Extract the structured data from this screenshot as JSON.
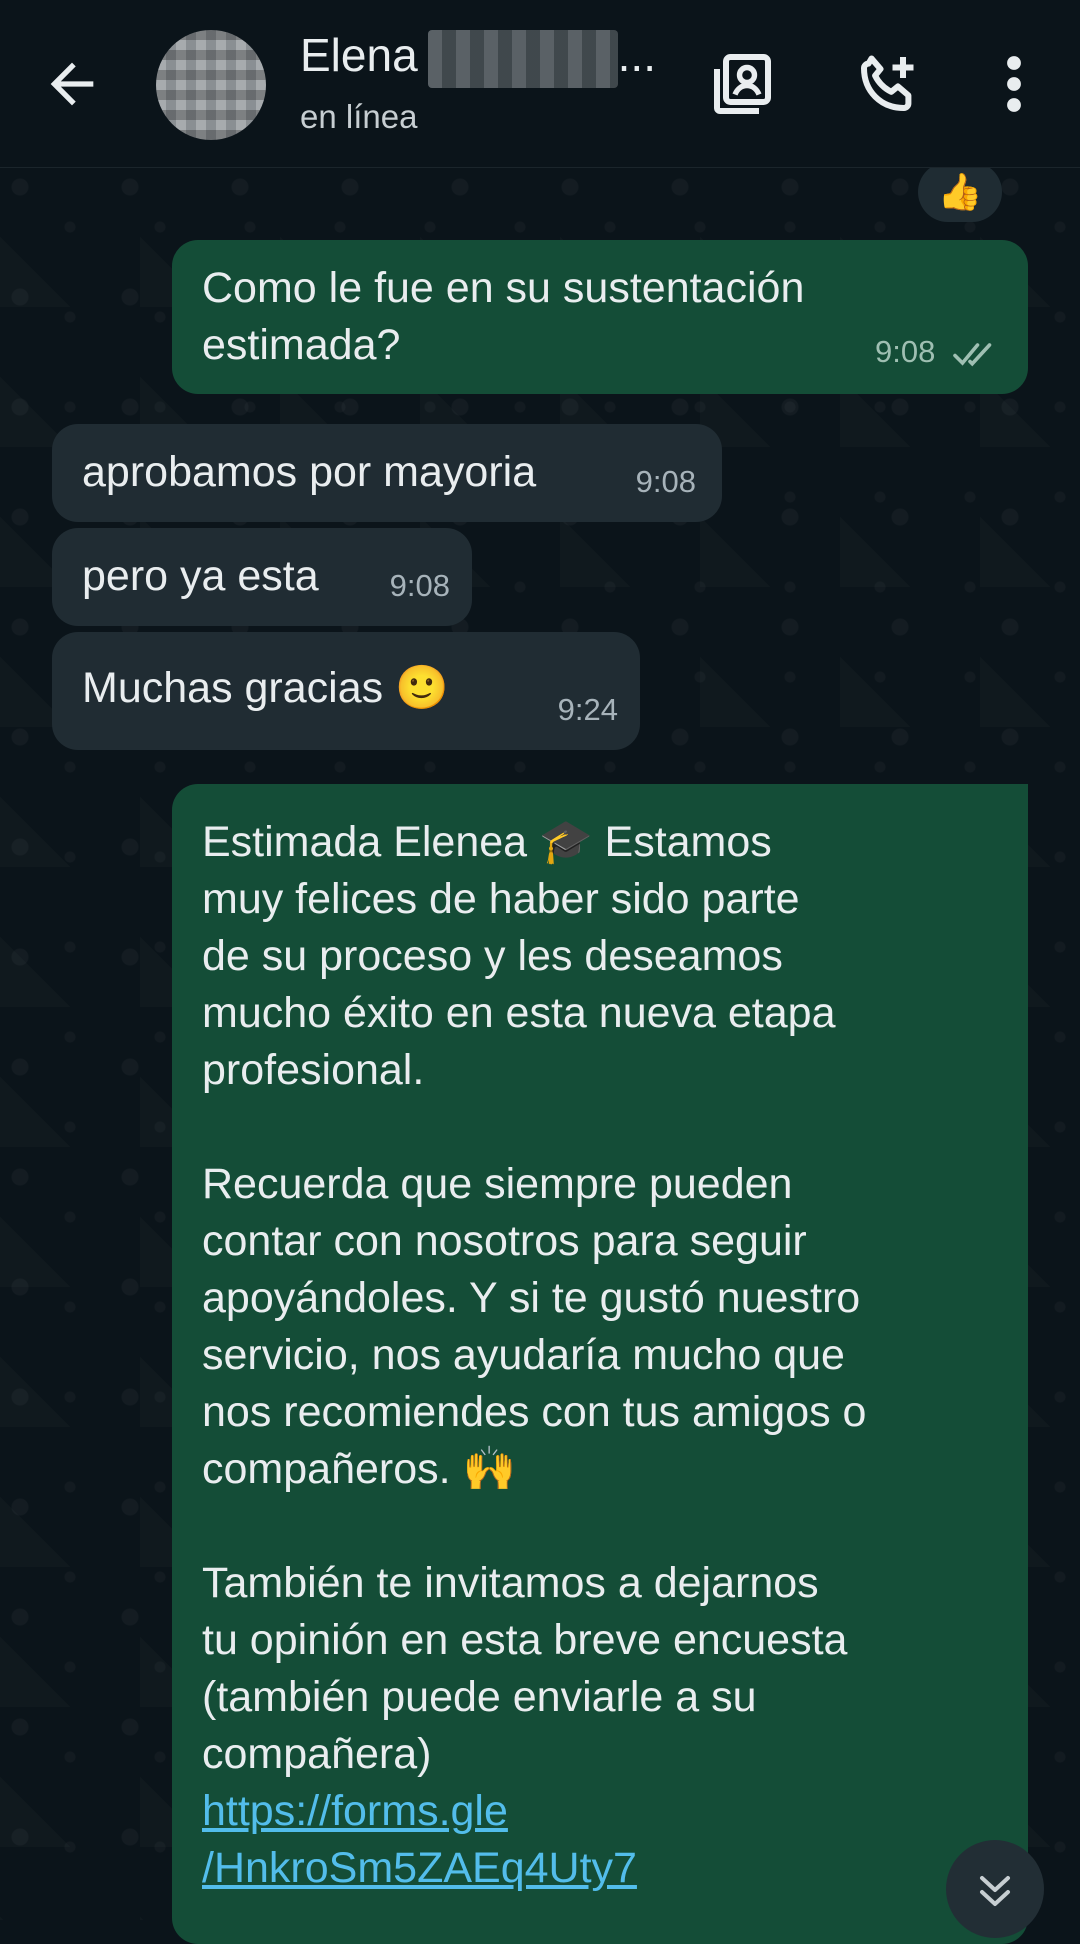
{
  "header": {
    "contact_name": "Elena",
    "name_ellipsis": "...",
    "status": "en línea"
  },
  "icons": {
    "back": "arrow-left-icon",
    "contacts": "contacts-book-icon",
    "call_add": "add-call-icon",
    "menu": "more-vertical-icon",
    "scroll_down": "double-chevron-down-icon"
  },
  "reaction": "👍",
  "messages": [
    {
      "direction": "out",
      "text_lines": [
        "Como le fue en su sustentación",
        "estimada?"
      ],
      "time": "9:08",
      "read": true
    },
    {
      "direction": "in",
      "text": "aprobamos por mayoria",
      "time": "9:08"
    },
    {
      "direction": "in",
      "text": "pero ya esta",
      "time": "9:08"
    },
    {
      "direction": "in",
      "text": "Muchas gracias 🙂",
      "time": "9:24"
    },
    {
      "direction": "out",
      "p1_lines": [
        "Estimada Elenea 🎓 Estamos",
        "muy felices de haber sido parte",
        "de su proceso y les deseamos",
        "mucho éxito en esta nueva etapa",
        "profesional."
      ],
      "p2_lines": [
        "Recuerda que siempre pueden",
        "contar con nosotros para seguir",
        "apoyándoles. Y si te gustó nuestro",
        "servicio, nos ayudaría mucho que",
        "nos recomiendes con tus amigos o",
        "compañeros. 🙌"
      ],
      "p3_lines": [
        "También te invitamos a dejarnos",
        "tu opinión en esta breve encuesta",
        "(también puede enviarle a su",
        "compañera)"
      ],
      "link_lines": [
        "https://forms.gle",
        "/HnkroSm5ZAEq4Uty7"
      ]
    }
  ],
  "colors": {
    "outgoing_bubble": "#144d37",
    "incoming_bubble": "#202c33",
    "background": "#0b141a",
    "link": "#53bdeb"
  }
}
